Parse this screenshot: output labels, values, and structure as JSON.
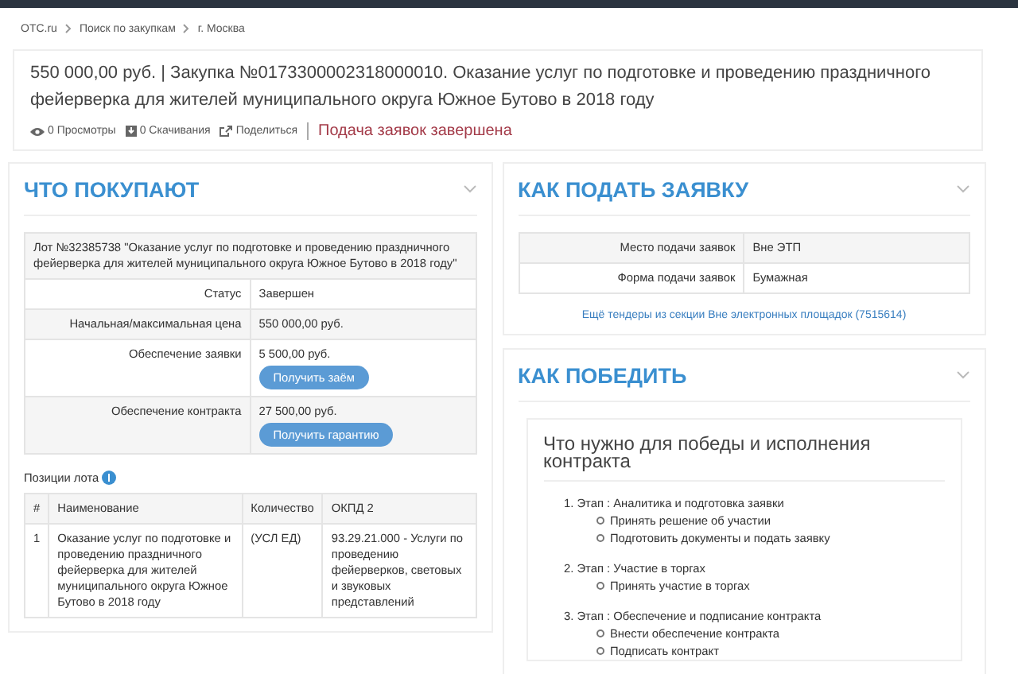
{
  "breadcrumbs": [
    "OTC.ru",
    "Поиск по закупкам",
    "г. Москва"
  ],
  "header": {
    "title": "550 000,00 руб. | Закупка №0173300002318000010. Оказание услуг по подготовке и проведению праздничного фейерверка для жителей муниципального округа Южное Бутово в 2018 году",
    "stats": [
      {
        "kind": "views",
        "label": "0 Просмотры"
      },
      {
        "kind": "downloads",
        "label": "0 Скачивания"
      },
      {
        "kind": "share",
        "label": "Поделиться"
      }
    ],
    "status": "Подача заявок завершена"
  },
  "what": {
    "title": "ЧТО ПОКУПАЮТ",
    "lot": "Лот №32385738 \"Оказание услуг по подготовке и проведению праздничного фейерверка для жителей муниципального округа Южное Бутово в 2018 году\"",
    "rows": [
      {
        "label": "Статус",
        "value": "Завершен"
      },
      {
        "label": "Начальная/максимальная цена",
        "value": "550 000,00 руб."
      },
      {
        "label": "Обеспечение заявки",
        "value": "5 500,00 руб.",
        "button": "Получить заём"
      },
      {
        "label": "Обеспечение контракта",
        "value": "27 500,00 руб.",
        "button": "Получить гарантию"
      }
    ],
    "positions_label": "Позиции лота",
    "columns": [
      "#",
      "Наименование",
      "Количество",
      "ОКПД 2"
    ],
    "positions": [
      [
        "1",
        "Оказание услуг по подготовке и проведению праздничного фейерверка для жителей муниципального округа Южное Бутово в 2018 году",
        "(УСЛ ЕД)",
        "93.29.21.000 - Услуги по проведению фейерверков, световых и звуковых представлений"
      ]
    ]
  },
  "how_apply": {
    "title": "КАК ПОДАТЬ ЗАЯВКУ",
    "rows": [
      {
        "label": "Место подачи заявок",
        "value": "Вне ЭТП"
      },
      {
        "label": "Форма подачи заявок",
        "value": "Бумажная"
      }
    ],
    "link": "Ещё тендеры из секции Вне электронных площадок (7515614)"
  },
  "how_win": {
    "title": "КАК ПОБЕДИТЬ",
    "heading": "Что нужно для победы и исполнения контракта",
    "stages": [
      {
        "title": "1. Этап : Аналитика и подготовка заявки",
        "steps": [
          "Принять решение об участии",
          "Подготовить документы и подать заявку"
        ]
      },
      {
        "title": "2. Этап : Участие в торгах",
        "steps": [
          "Принять участие в торгах"
        ]
      },
      {
        "title": "3. Этап : Обеспечение и подписание контракта",
        "steps": [
          "Внести обеспечение контракта",
          "Подписать контракт"
        ]
      }
    ]
  }
}
